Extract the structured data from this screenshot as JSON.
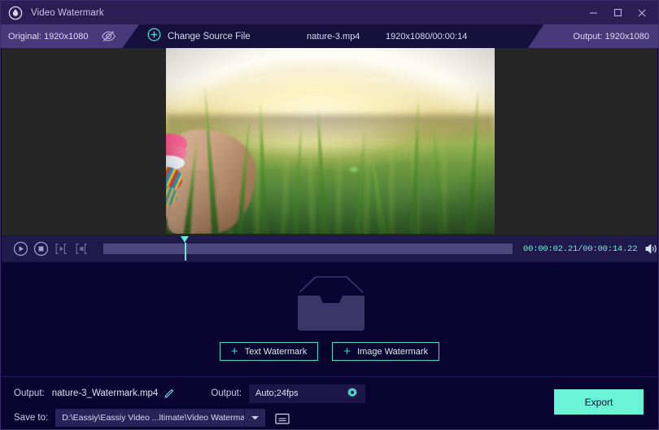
{
  "window": {
    "title": "Video Watermark",
    "logo_icon": "droplet-circle-icon",
    "minimize_label": "—",
    "maximize_label": "□",
    "close_label": "✕"
  },
  "toolbar": {
    "original_tab": "Original: 1920x1080",
    "eye_hidden_icon": "eye-slash-icon",
    "change_source_icon": "plus-circle-icon",
    "change_source_label": "Change Source File",
    "file_name": "nature-3.mp4",
    "file_meta": "1920x1080/00:00:14",
    "output_tab": "Output: 1920x1080"
  },
  "player": {
    "play_icon": "play-circle-icon",
    "stop_icon": "stop-circle-icon",
    "mark_in_icon": "bracket-play-icon",
    "mark_out_icon": "bracket-stop-icon",
    "timecode": "00:00:02.21/00:00:14.22",
    "current_time": "00:00:02.21",
    "total_time": "00:00:14.22",
    "volume_icon": "speaker-icon",
    "playhead_percent": 19
  },
  "center": {
    "tray_icon": "inbox-tray-icon",
    "text_watermark_label": "Text Watermark",
    "image_watermark_label": "Image Watermark",
    "add_icon": "plus-icon"
  },
  "bottom": {
    "output_name_label": "Output:",
    "output_name_value": "nature-3_Watermark.mp4",
    "edit_icon": "pencil-icon",
    "output_format_label": "Output:",
    "output_format_value": "Auto;24fps",
    "settings_icon": "gear-icon",
    "save_to_label": "Save to:",
    "save_to_value": "D:\\Eassiy\\Eassiy Video ...ltimate\\Video Watermark",
    "dropdown_icon": "chevron-down-icon",
    "folder_icon": "folder-open-icon",
    "export_label": "Export"
  },
  "colors": {
    "accent_cyan": "#49d8c8",
    "export_green": "#6af3d7",
    "titlebar": "#2a1f55",
    "toolbar": "#15103c",
    "tab_active": "#473a7a",
    "body_bg": "#0a0530",
    "playbar": "#201a4c"
  }
}
